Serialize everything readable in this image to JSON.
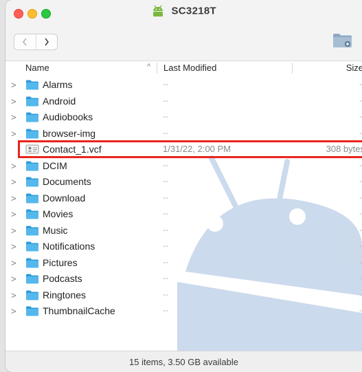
{
  "window": {
    "title": "SC3218T",
    "title_icon": "android-robot-icon",
    "buttons": [
      "close",
      "minimize",
      "zoom"
    ]
  },
  "toolbar": {
    "back_icon": "chevron-left-icon",
    "forward_icon": "chevron-right-icon",
    "new_folder_icon": "new-folder-icon"
  },
  "columns": {
    "name": "Name",
    "last_modified": "Last Modified",
    "size": "Size",
    "sort_indicator": "^"
  },
  "rows": [
    {
      "name": "Alarms",
      "type": "folder",
      "modified": "--",
      "size": "--"
    },
    {
      "name": "Android",
      "type": "folder",
      "modified": "--",
      "size": "--"
    },
    {
      "name": "Audiobooks",
      "type": "folder",
      "modified": "--",
      "size": "--"
    },
    {
      "name": "browser-img",
      "type": "folder",
      "modified": "--",
      "size": "--"
    },
    {
      "name": "Contact_1.vcf",
      "type": "file",
      "modified": "1/31/22, 2:00 PM",
      "size": "308 bytes"
    },
    {
      "name": "DCIM",
      "type": "folder",
      "modified": "--",
      "size": "--"
    },
    {
      "name": "Documents",
      "type": "folder",
      "modified": "--",
      "size": "--"
    },
    {
      "name": "Download",
      "type": "folder",
      "modified": "--",
      "size": "--"
    },
    {
      "name": "Movies",
      "type": "folder",
      "modified": "--",
      "size": "--"
    },
    {
      "name": "Music",
      "type": "folder",
      "modified": "--",
      "size": "--"
    },
    {
      "name": "Notifications",
      "type": "folder",
      "modified": "--",
      "size": "--"
    },
    {
      "name": "Pictures",
      "type": "folder",
      "modified": "--",
      "size": "--"
    },
    {
      "name": "Podcasts",
      "type": "folder",
      "modified": "--",
      "size": "--"
    },
    {
      "name": "Ringtones",
      "type": "folder",
      "modified": "--",
      "size": "--"
    },
    {
      "name": "ThumbnailCache",
      "type": "folder",
      "modified": "--",
      "size": "--"
    }
  ],
  "highlighted_row": "Contact_1.vcf",
  "status": "15 items, 3.50 GB available",
  "colors": {
    "folder": "#3fa8e0",
    "highlight_border": "#e8241d",
    "watermark": "#c9d8ea"
  }
}
